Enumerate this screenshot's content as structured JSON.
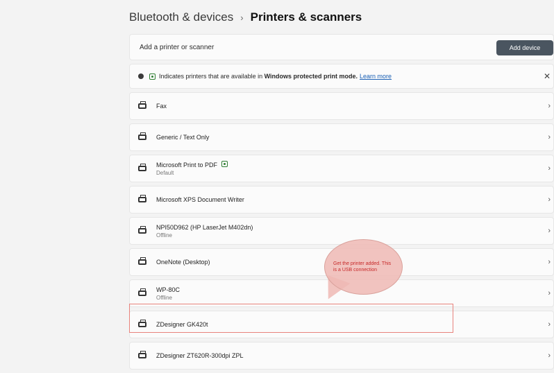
{
  "header": {
    "parent": "Bluetooth & devices",
    "separator": "›",
    "current": "Printers & scanners"
  },
  "add_printer": {
    "label": "Add a printer or scanner",
    "button": "Add device"
  },
  "info": {
    "text_before": "Indicates printers that are available in",
    "bold_text": "Windows protected print mode.",
    "link": "Learn more",
    "close": "✕"
  },
  "printers": [
    {
      "name": "Fax",
      "status": "",
      "shield": false
    },
    {
      "name": "Generic / Text Only",
      "status": "",
      "shield": false
    },
    {
      "name": "Microsoft Print to PDF",
      "status": "Default",
      "shield": true
    },
    {
      "name": "Microsoft XPS Document Writer",
      "status": "",
      "shield": false
    },
    {
      "name": "NPI50D962 (HP LaserJet M402dn)",
      "status": "Offline",
      "shield": false
    },
    {
      "name": "OneNote (Desktop)",
      "status": "",
      "shield": false
    },
    {
      "name": "WP-80C",
      "status": "Offline",
      "shield": false
    },
    {
      "name": "ZDesigner GK420t",
      "status": "",
      "shield": false
    },
    {
      "name": "ZDesigner ZT620R-300dpi ZPL",
      "status": "",
      "shield": false
    }
  ],
  "chevron": "›",
  "annotation": {
    "text": "Get the printer added. This is a USB connection",
    "color": "#c62828"
  }
}
